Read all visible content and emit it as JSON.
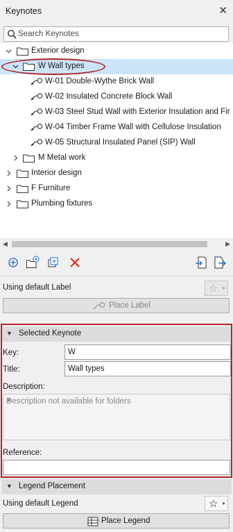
{
  "panel": {
    "title": "Keynotes"
  },
  "search": {
    "placeholder": "Search Keynotes"
  },
  "tree": {
    "exterior": "Exterior design",
    "wall_types": "W Wall types",
    "items": [
      "W-01 Double-Wythe Brick Wall",
      "W-02 Insulated Concrete Block Wall",
      "W-03 Steel Stud Wall with Exterior Insulation and Fir",
      "W-04 Timber Frame Wall with Cellulose Insulation",
      "W-05 Structural Insulated Panel (SIP) Wall"
    ],
    "metal": "M Metal work",
    "interior": "Interior design",
    "furniture": "F Furniture",
    "plumbing": "Plumbing fixtures"
  },
  "label_area": {
    "text": "Using default Label",
    "place": "Place Label"
  },
  "selected": {
    "header": "Selected Keynote",
    "key_label": "Key:",
    "key_value": "W",
    "title_label": "Title:",
    "title_value": "Wall types",
    "description_label": "Description:",
    "description_value": "Description not available for folders",
    "reference_label": "Reference:"
  },
  "legend": {
    "header": "Legend Placement",
    "text": "Using default Legend",
    "place": "Place Legend"
  },
  "colors": {
    "selection": "#cce4f7",
    "accent_blue": "#1f6fd0",
    "delete_red": "#e0301e",
    "highlight": "#b2242b"
  }
}
